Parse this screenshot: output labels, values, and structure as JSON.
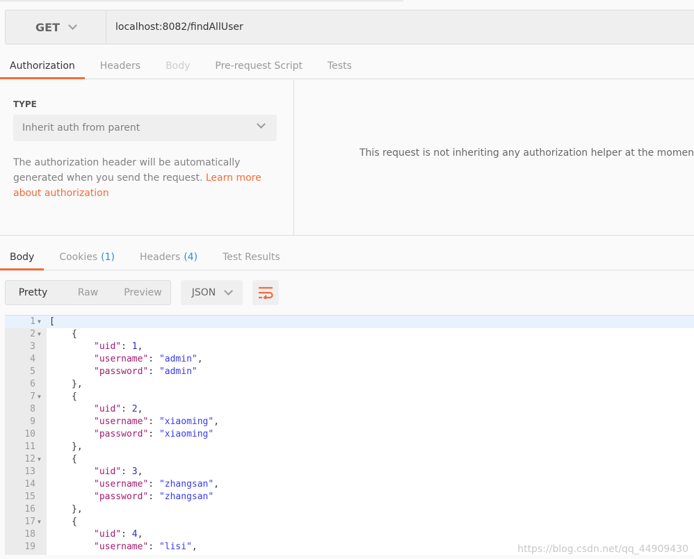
{
  "request": {
    "method": "GET",
    "url": "localhost:8082/findAllUser"
  },
  "request_tabs": [
    {
      "label": "Authorization",
      "state": "active"
    },
    {
      "label": "Headers",
      "state": "normal"
    },
    {
      "label": "Body",
      "state": "disabled"
    },
    {
      "label": "Pre-request Script",
      "state": "normal"
    },
    {
      "label": "Tests",
      "state": "normal"
    }
  ],
  "auth": {
    "type_label": "TYPE",
    "type_value": "Inherit auth from parent",
    "description": "The authorization header will be automatically generated when you send the request. ",
    "learn_more": "Learn more about authorization",
    "message": "This request is not inheriting any authorization helper at the moment"
  },
  "response_tabs": [
    {
      "label": "Body",
      "count": "",
      "state": "active"
    },
    {
      "label": "Cookies",
      "count": "(1)",
      "state": "normal"
    },
    {
      "label": "Headers",
      "count": "(4)",
      "state": "normal"
    },
    {
      "label": "Test Results",
      "count": "",
      "state": "normal"
    }
  ],
  "view_modes": [
    "Pretty",
    "Raw",
    "Preview"
  ],
  "active_view": "Pretty",
  "format": "JSON",
  "wrap_icon": "wrap-lines-icon",
  "colors": {
    "accent": "#f26b3a",
    "key": "#a11b6f",
    "string": "#3a3ae8",
    "number": "#2d2db5",
    "count": "#2e8bdb"
  },
  "code_lines": [
    {
      "n": "1",
      "fold": true,
      "i": 0,
      "t": [
        [
          "p",
          "["
        ]
      ]
    },
    {
      "n": "2",
      "fold": true,
      "i": 1,
      "t": [
        [
          "p",
          "{"
        ]
      ]
    },
    {
      "n": "3",
      "i": 2,
      "t": [
        [
          "k",
          "\"uid\""
        ],
        [
          "p",
          ": "
        ],
        [
          "n",
          "1"
        ],
        [
          "p",
          ","
        ]
      ]
    },
    {
      "n": "4",
      "i": 2,
      "t": [
        [
          "k",
          "\"username\""
        ],
        [
          "p",
          ": "
        ],
        [
          "s",
          "\"admin\""
        ],
        [
          "p",
          ","
        ]
      ]
    },
    {
      "n": "5",
      "i": 2,
      "t": [
        [
          "k",
          "\"password\""
        ],
        [
          "p",
          ": "
        ],
        [
          "s",
          "\"admin\""
        ]
      ]
    },
    {
      "n": "6",
      "i": 1,
      "t": [
        [
          "p",
          "},"
        ]
      ]
    },
    {
      "n": "7",
      "fold": true,
      "i": 1,
      "t": [
        [
          "p",
          "{"
        ]
      ]
    },
    {
      "n": "8",
      "i": 2,
      "t": [
        [
          "k",
          "\"uid\""
        ],
        [
          "p",
          ": "
        ],
        [
          "n",
          "2"
        ],
        [
          "p",
          ","
        ]
      ]
    },
    {
      "n": "9",
      "i": 2,
      "t": [
        [
          "k",
          "\"username\""
        ],
        [
          "p",
          ": "
        ],
        [
          "s",
          "\"xiaoming\""
        ],
        [
          "p",
          ","
        ]
      ]
    },
    {
      "n": "10",
      "i": 2,
      "t": [
        [
          "k",
          "\"password\""
        ],
        [
          "p",
          ": "
        ],
        [
          "s",
          "\"xiaoming\""
        ]
      ]
    },
    {
      "n": "11",
      "i": 1,
      "t": [
        [
          "p",
          "},"
        ]
      ]
    },
    {
      "n": "12",
      "fold": true,
      "i": 1,
      "t": [
        [
          "p",
          "{"
        ]
      ]
    },
    {
      "n": "13",
      "i": 2,
      "t": [
        [
          "k",
          "\"uid\""
        ],
        [
          "p",
          ": "
        ],
        [
          "n",
          "3"
        ],
        [
          "p",
          ","
        ]
      ]
    },
    {
      "n": "14",
      "i": 2,
      "t": [
        [
          "k",
          "\"username\""
        ],
        [
          "p",
          ": "
        ],
        [
          "s",
          "\"zhangsan\""
        ],
        [
          "p",
          ","
        ]
      ]
    },
    {
      "n": "15",
      "i": 2,
      "t": [
        [
          "k",
          "\"password\""
        ],
        [
          "p",
          ": "
        ],
        [
          "s",
          "\"zhangsan\""
        ]
      ]
    },
    {
      "n": "16",
      "i": 1,
      "t": [
        [
          "p",
          "},"
        ]
      ]
    },
    {
      "n": "17",
      "fold": true,
      "i": 1,
      "t": [
        [
          "p",
          "{"
        ]
      ]
    },
    {
      "n": "18",
      "i": 2,
      "t": [
        [
          "k",
          "\"uid\""
        ],
        [
          "p",
          ": "
        ],
        [
          "n",
          "4"
        ],
        [
          "p",
          ","
        ]
      ]
    },
    {
      "n": "19",
      "i": 2,
      "t": [
        [
          "k",
          "\"username\""
        ],
        [
          "p",
          ": "
        ],
        [
          "s",
          "\"lisi\""
        ],
        [
          "p",
          ","
        ]
      ]
    }
  ],
  "watermark": "https://blog.csdn.net/qq_44909430"
}
